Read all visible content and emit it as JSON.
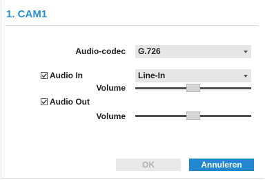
{
  "title": "1. CAM1",
  "audio_codec": {
    "label": "Audio-codec",
    "value": "G.726"
  },
  "audio_in": {
    "label": "Audio In",
    "checked": true,
    "source_value": "Line-In",
    "volume_label": "Volume",
    "volume_level": 0.5
  },
  "audio_out": {
    "label": "Audio Out",
    "checked": true,
    "volume_label": "Volume",
    "volume_level": 0.5
  },
  "buttons": {
    "ok": "OK",
    "cancel": "Annuleren"
  },
  "colors": {
    "accent": "#2a8fd2",
    "button_primary": "#2188cf"
  }
}
